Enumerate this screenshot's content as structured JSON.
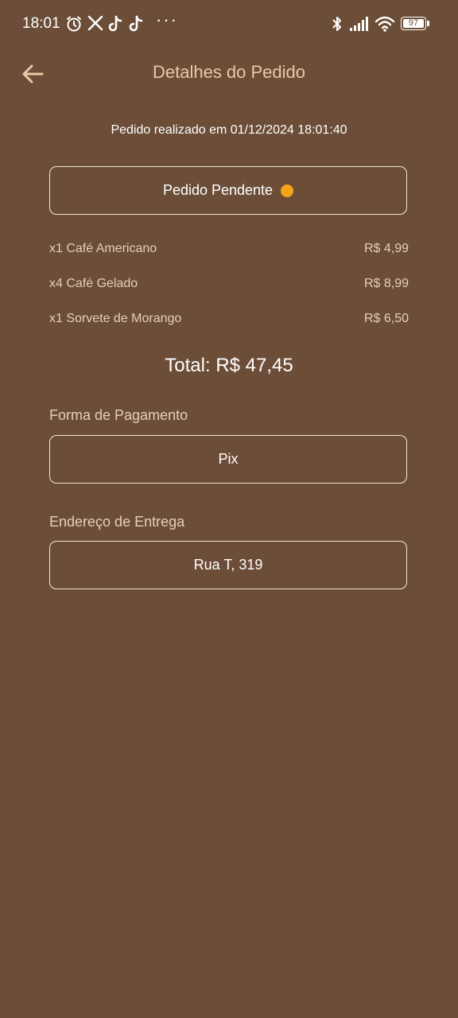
{
  "status_bar": {
    "time": "18:01",
    "battery": "97",
    "icons": [
      "alarm-icon",
      "x-icon",
      "tiktok-icon",
      "tiktok-icon",
      "more-dots-icon",
      "bluetooth-icon",
      "signal-icon",
      "wifi-icon",
      "battery-icon"
    ],
    "dots": "···"
  },
  "header": {
    "back_icon": "arrow-left-icon",
    "title": "Detalhes do Pedido"
  },
  "order": {
    "date_text": "Pedido realizado em 01/12/2024 18:01:40",
    "status_label": "Pedido Pendente",
    "status_color": "#f5a416",
    "items": [
      {
        "name": "x1 Café Americano",
        "price": "R$ 4,99"
      },
      {
        "name": "x4 Café Gelado",
        "price": "R$ 8,99"
      },
      {
        "name": "x1 Sorvete de Morango",
        "price": "R$ 6,50"
      }
    ],
    "total": "Total: R$ 47,45"
  },
  "payment": {
    "label": "Forma de Pagamento",
    "value": "Pix"
  },
  "delivery": {
    "label": "Endereço de Entrega",
    "value": "Rua T, 319"
  },
  "colors": {
    "background": "#6c4e38",
    "title": "#ecc7a8",
    "muted_text": "#e8cdb8",
    "border": "#f0e4da"
  }
}
